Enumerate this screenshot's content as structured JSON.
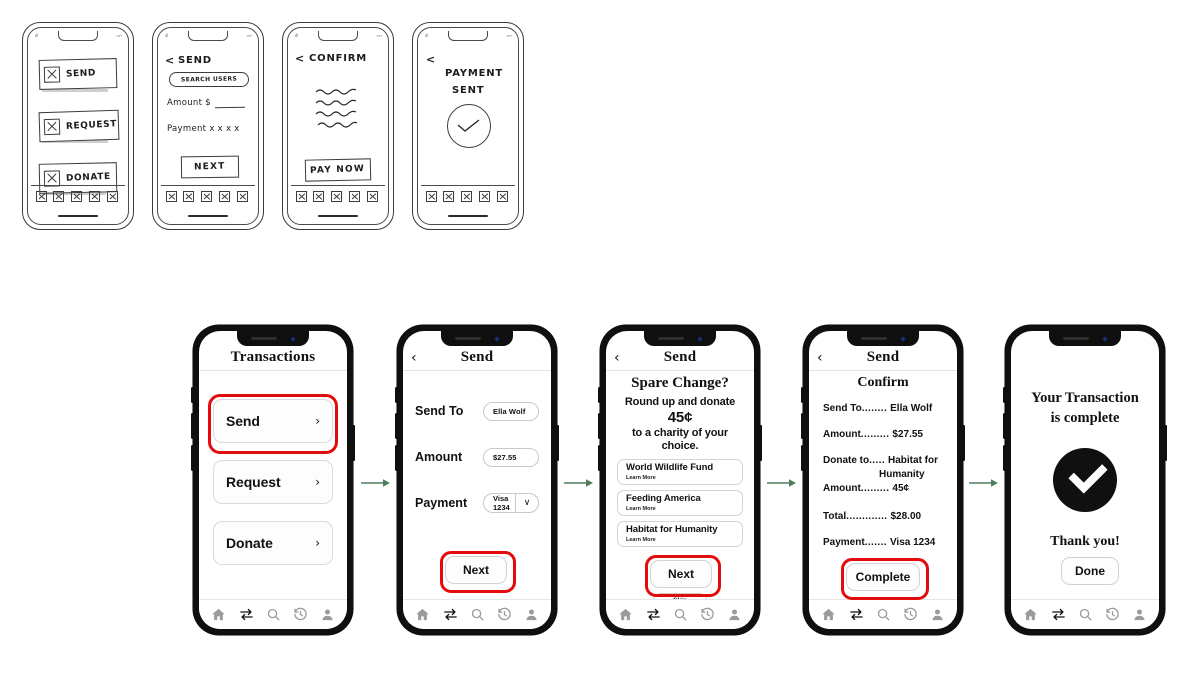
{
  "wireframe_sketches": [
    {
      "id": "sketch-home",
      "status_signal": "ıll",
      "status_battery": "▭⌁",
      "items": [
        {
          "label": "SEND"
        },
        {
          "label": "REQUEST"
        },
        {
          "label": "DONATE"
        }
      ]
    },
    {
      "id": "sketch-send",
      "back": "<",
      "title": "SEND",
      "search_pill": "SEARCH USERS",
      "amount_line": "Amount $",
      "payment_line": "Payment  x x x x",
      "cta": "NEXT"
    },
    {
      "id": "sketch-confirm",
      "back": "<",
      "title": "CONFIRM",
      "cta": "PAY NOW"
    },
    {
      "id": "sketch-sent",
      "back": "<",
      "title_line1": "PAYMENT",
      "title_line2": "SENT"
    }
  ],
  "flow_arrows": {
    "count": 4,
    "color": "#4e7d5c"
  },
  "nav": {
    "items": [
      {
        "name": "home-icon",
        "active": false
      },
      {
        "name": "transfer-icon",
        "active": true
      },
      {
        "name": "search-icon",
        "active": false
      },
      {
        "name": "history-icon",
        "active": false
      },
      {
        "name": "profile-icon",
        "active": false
      }
    ]
  },
  "highlight_color": "#e30b0b",
  "screens": [
    {
      "id": "transactions",
      "title": "Transactions",
      "back": null,
      "menu": [
        {
          "label": "Send",
          "chevron": "›",
          "highlighted": true
        },
        {
          "label": "Request",
          "chevron": "›",
          "highlighted": false
        },
        {
          "label": "Donate",
          "chevron": "›",
          "highlighted": false
        }
      ]
    },
    {
      "id": "send-form",
      "title": "Send",
      "back": "‹",
      "fields": [
        {
          "label": "Send To",
          "value": "Ella Wolf",
          "type": "text"
        },
        {
          "label": "Amount",
          "value": "$27.55",
          "type": "text"
        },
        {
          "label": "Payment",
          "value": "Visa 1234",
          "type": "select",
          "chevron": "∨"
        }
      ],
      "cta": {
        "label": "Next",
        "highlighted": true
      }
    },
    {
      "id": "spare-change",
      "title": "Send",
      "back": "‹",
      "heading": "Spare Change?",
      "sub_line1": "Round up and donate",
      "amount": "45¢",
      "sub_line2": "to a charity of your",
      "sub_line3": "choice.",
      "charities": [
        {
          "name": "World Wildlife Fund",
          "link": "Learn More"
        },
        {
          "name": "Feeding America",
          "link": "Learn More"
        },
        {
          "name": "Habitat for Humanity",
          "link": "Learn More"
        }
      ],
      "cta": {
        "label": "Next",
        "highlighted": true
      },
      "skip": "Skip"
    },
    {
      "id": "confirm",
      "title": "Send",
      "back": "‹",
      "heading": "Confirm",
      "rows": [
        {
          "key": "Send To",
          "dots": "........",
          "value": "Ella Wolf"
        },
        {
          "key": "Amount",
          "dots": ".........",
          "value": "$27.55"
        },
        {
          "key": "Donate to",
          "dots": ".....",
          "value": "Habitat for",
          "value2": "Humanity"
        },
        {
          "key": "Amount",
          "dots": ".........",
          "value": "45¢"
        },
        {
          "key": "Total",
          "dots": " .............",
          "value": "$28.00"
        },
        {
          "key": "Payment",
          "dots": ".......",
          "value": "Visa 1234"
        }
      ],
      "cta": {
        "label": "Complete",
        "highlighted": true
      }
    },
    {
      "id": "success",
      "title": null,
      "back": null,
      "heading_line1": "Your Transaction",
      "heading_line2": "is complete",
      "icon": "check-circle-icon",
      "thanks": "Thank you!",
      "cta": {
        "label": "Done",
        "highlighted": false
      }
    }
  ]
}
